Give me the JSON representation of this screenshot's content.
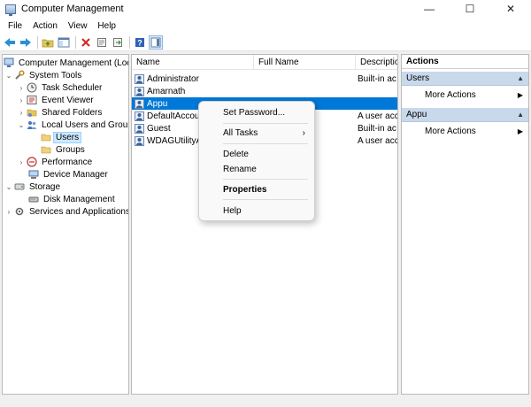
{
  "window": {
    "title": "Computer Management",
    "minimize": "—",
    "maximize": "☐",
    "close": "✕"
  },
  "menu": [
    "File",
    "Action",
    "View",
    "Help"
  ],
  "tree": {
    "root": "Computer Management (Local",
    "system_tools": "System Tools",
    "task_scheduler": "Task Scheduler",
    "event_viewer": "Event Viewer",
    "shared_folders": "Shared Folders",
    "local_users": "Local Users and Groups",
    "users": "Users",
    "groups": "Groups",
    "performance": "Performance",
    "device_manager": "Device Manager",
    "storage": "Storage",
    "disk_management": "Disk Management",
    "services": "Services and Applications"
  },
  "list": {
    "columns": [
      "Name",
      "Full Name",
      "Description"
    ],
    "rows": [
      {
        "name": "Administrator",
        "full": "",
        "desc": "Built-in ac"
      },
      {
        "name": "Amarnath",
        "full": "",
        "desc": ""
      },
      {
        "name": "Appu",
        "full": "",
        "desc": ""
      },
      {
        "name": "DefaultAccoun",
        "full": "",
        "desc": "A user acc"
      },
      {
        "name": "Guest",
        "full": "",
        "desc": "Built-in ac"
      },
      {
        "name": "WDAGUtilityA",
        "full": "",
        "desc": "A user acc"
      }
    ]
  },
  "context_menu": {
    "set_password": "Set Password...",
    "all_tasks": "All Tasks",
    "all_tasks_arrow": "›",
    "delete": "Delete",
    "rename": "Rename",
    "properties": "Properties",
    "help": "Help"
  },
  "actions": {
    "title": "Actions",
    "section1": "Users",
    "section1_more": "More Actions",
    "section2": "Appu",
    "section2_more": "More Actions",
    "collapse": "▲",
    "more_arrow": "▶"
  },
  "colors": {
    "selection": "#0078d7",
    "section_bg": "#c9d9ec"
  }
}
